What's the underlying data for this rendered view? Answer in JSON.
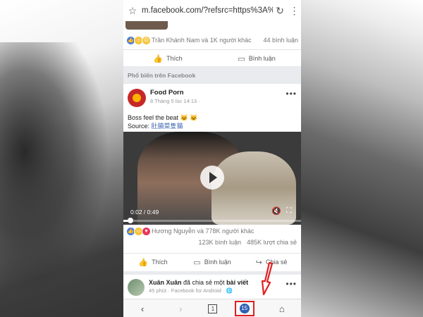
{
  "browser": {
    "url": "m.facebook.com/?refsrc=https%3A%",
    "star_icon": "☆",
    "reload_icon": "↻",
    "menu_icon": "⋮"
  },
  "prev_post": {
    "reactions_text": "Trần Khánh Nam và 1K người khác",
    "comments": "44 bình luận",
    "like_label": "Thích",
    "comment_label": "Bình luận"
  },
  "section_label": "Phổ biến trên Facebook",
  "post": {
    "author": "Food Porn",
    "time": "8 Tháng 5 lúc 14:13 ·",
    "text_line1": "Boss feel the beat 🐱 🐱",
    "source_prefix": "Source: ",
    "source_link": "肚腩菜隻貓",
    "video_time": "0:02 / 0:49",
    "video_progress": 0.04,
    "reactions_text": "Hương Nguyễn và 778K người khác",
    "comments": "123K bình luận",
    "shares": "485K lượt chia sẻ",
    "like_label": "Thích",
    "comment_label": "Bình luận",
    "share_label": "Chia sẻ"
  },
  "post2": {
    "author": "Xuân Xuân",
    "action": " đã chia sẻ một ",
    "object": "bài viết",
    "meta": "45 phút · Facebook for Android · 🌐"
  },
  "bottom_nav": {
    "back_icon": "‹",
    "forward_icon": "›",
    "tabs_count": "1",
    "notifications": "15",
    "home_icon": "⌂"
  },
  "colors": {
    "facebook_blue": "#4267b2",
    "highlight_red": "#e02020",
    "notification_blue": "#2f5fb3"
  }
}
